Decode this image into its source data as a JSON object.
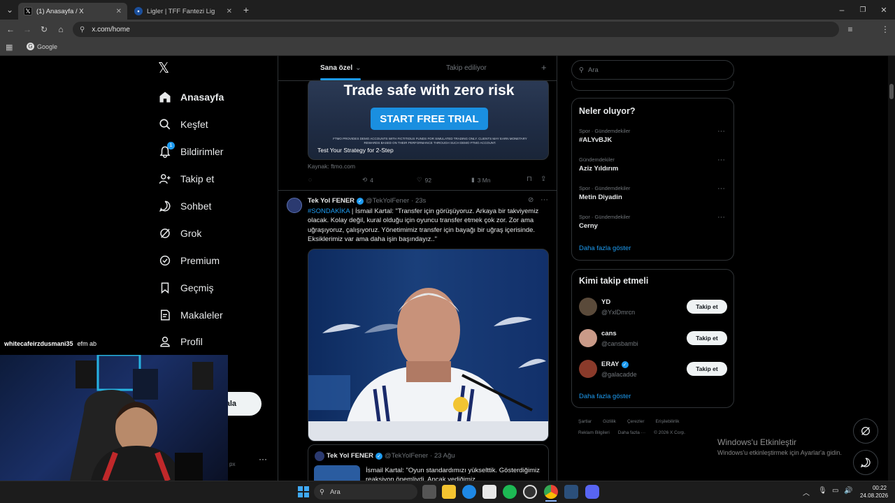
{
  "browser": {
    "tabs": [
      {
        "label": "(1) Anasayfa / X",
        "active": true
      },
      {
        "label": "Ligler | TFF Fantezi Lig",
        "active": false
      }
    ],
    "url": "x.com/home",
    "bookmark": "Google"
  },
  "nav": {
    "items": [
      {
        "label": "Anasayfa",
        "icon": "home-icon"
      },
      {
        "label": "Keşfet",
        "icon": "search-icon"
      },
      {
        "label": "Bildirimler",
        "icon": "bell-icon",
        "badge": "1"
      },
      {
        "label": "Takip et",
        "icon": "follow-icon"
      },
      {
        "label": "Sohbet",
        "icon": "chat-icon"
      },
      {
        "label": "Grok",
        "icon": "grok-icon"
      },
      {
        "label": "Premium",
        "icon": "premium-icon"
      },
      {
        "label": "Geçmiş",
        "icon": "bookmark-icon"
      },
      {
        "label": "Makaleler",
        "icon": "articles-icon"
      },
      {
        "label": "Profil",
        "icon": "profile-icon"
      }
    ],
    "post_button_partial": "ala",
    "account_partial": "px"
  },
  "feed": {
    "tabs": {
      "for_you": "Sana özel",
      "following": "Takip ediliyor"
    },
    "ad": {
      "headline": "Trade safe with zero risk",
      "cta": "START FREE TRIAL",
      "fineprint": "FTMO PROVIDES DEMO ACCOUNTS WITH FICTITIOUS FUNDS FOR SIMULATED TRADING ONLY. CLIENTS MAY EARN MONETARY REWARDS BASED ON THEIR PERFORMANCE THROUGH SUCH DEMO FTMO ACCOUNT.",
      "caption": "Test Your Strategy for 2-Step",
      "source": "Kaynak: ftmo.com",
      "retweets": "4",
      "likes": "92",
      "views": "3 Mn"
    },
    "post": {
      "author": "Tek Yol FENER",
      "handle": "@TekYolFener",
      "time": "· 23s",
      "hashtag": "#SONDAKİKA",
      "text": " | İsmail Kartal: \"Transfer için görüşüyoruz. Arkaya bir takviyemiz olacak. Kolay değil, kural olduğu için oyuncu transfer etmek çok zor. Zor ama uğraşıyoruz, çalışıyoruz. Yönetimimiz transfer için bayağı bir uğraş içerisinde. Eksiklerimiz var ama daha işin başındayız..\""
    },
    "quote": {
      "author": "Tek Yol FENER",
      "handle": "@TekYolFener",
      "time": "· 23 Ağu",
      "text": "İsmail Kartal: \"Oyun standardımızı yükselttik. Gösterdiğimiz reaksiyon önemliydi. Ancak yediğimiz"
    }
  },
  "right": {
    "search_placeholder": "Ara",
    "trends_title": "Neler oluyor?",
    "trends": [
      {
        "category": "Spor · Gündemdekiler",
        "name": "#ALYvBJK"
      },
      {
        "category": "Gündemdekiler",
        "name": "Aziz Yıldırım"
      },
      {
        "category": "Spor · Gündemdekiler",
        "name": "Metin Diyadin"
      },
      {
        "category": "Spor · Gündemdekiler",
        "name": "Cerny"
      }
    ],
    "show_more": "Daha fazla göster",
    "follow_title": "Kimi takip etmeli",
    "suggestions": [
      {
        "name": "YD",
        "handle": "@YxlDmrcn",
        "verified": false
      },
      {
        "name": "cans",
        "handle": "@cansbambi",
        "verified": false
      },
      {
        "name": "ERAY",
        "handle": "@galacadde",
        "verified": true
      }
    ],
    "follow_label": "Takip et",
    "show_more_2": "Daha fazla göster",
    "footer_row1": [
      "Şartlar",
      "Gizlilik",
      "Çerezler",
      "Erişilebilirlik"
    ],
    "footer_row2": [
      "Reklam Bilgileri",
      "Daha fazla ···",
      "© 2026 X Corp."
    ]
  },
  "overlay": {
    "chat_user": "whitecafeirzdusmani35",
    "chat_msg": "efm ab",
    "activation_title": "Windows'u Etkinleştir",
    "activation_sub": "Windows'u etkinleştirmek için Ayarlar'a gidin."
  },
  "taskbar": {
    "search": "Ara",
    "time": "00:22",
    "date": "24.08.2026"
  }
}
